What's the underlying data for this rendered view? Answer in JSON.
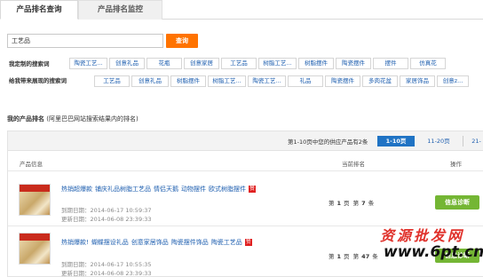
{
  "tabs": [
    {
      "label": "产品排名查询"
    },
    {
      "label": "产品排名监控"
    }
  ],
  "search": {
    "value": "工艺品",
    "button_label": "查询"
  },
  "custom_keywords": {
    "label": "我定制的搜索词",
    "items": [
      "陶瓷工艺...",
      "创意礼品",
      "花瓶",
      "创意家居",
      "工艺品",
      "树脂工艺...",
      "树脂摆件",
      "陶瓷摆件",
      "摆件",
      "仿真花"
    ]
  },
  "suggested_keywords": {
    "label": "给我带来展现的搜索词",
    "items": [
      "工艺品",
      "创意礼品",
      "树脂摆件",
      "树脂工艺...",
      "陶瓷工艺...",
      "礼品",
      "陶瓷摆件",
      "多肉花盆",
      "家居饰品",
      "创意z..."
    ]
  },
  "ranking": {
    "title": "我的产品排名",
    "subtitle": "(阿里巴巴网站搜索结果内的排名)",
    "summary": "第1-10页中您的供应产品有2条",
    "pages": [
      "1-10页",
      "11-20页",
      "21-"
    ],
    "columns": {
      "info": "产品信息",
      "rank": "当前排名",
      "action": "操作"
    },
    "rows": [
      {
        "title_words": [
          "热销超爆款",
          "铺庆礼品树脂工艺品",
          "情侣天鹅",
          "动物摆件",
          "欧式树脂摆件"
        ],
        "badge": "赞",
        "expire_label": "到期日期：",
        "expire": "2014-06-17 10:59:37",
        "update_label": "更新日期：",
        "update": "2014-06-08 23:39:33",
        "rank_prefix": "第",
        "page": "1",
        "page_unit": "页",
        "position_prefix": "第",
        "position": "7",
        "position_unit": "条",
        "action_label": "信息诊断"
      },
      {
        "title_words": [
          "热销爆款!",
          "蝴蝶摆设礼品",
          "创意家居饰品",
          "陶瓷摆件饰品",
          "陶瓷工艺品"
        ],
        "badge": "赞",
        "expire_label": "到期日期：",
        "expire": "2014-06-17 10:55:35",
        "update_label": "更新日期：",
        "update": "2014-06-08 23:39:33",
        "rank_prefix": "第",
        "page": "1",
        "page_unit": "页",
        "position_prefix": "第",
        "position": "47",
        "position_unit": "条",
        "action_label": "信息诊断"
      }
    ]
  },
  "watermark": {
    "line1": "资源批发网",
    "line2": "www.6pt.cn"
  }
}
